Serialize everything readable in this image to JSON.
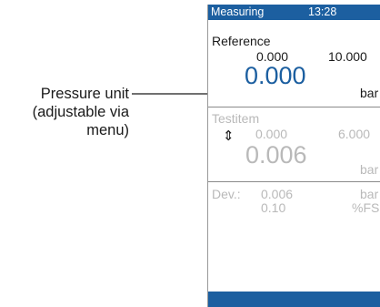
{
  "annotation": {
    "lines": [
      "Pressure unit",
      "(adjustable via",
      "menu)"
    ]
  },
  "device": {
    "status": {
      "mode": "Measuring",
      "clock": "13:28"
    },
    "reference": {
      "title": "Reference",
      "small_value": "0.000",
      "range_value": "10.000",
      "main_value": "0.000",
      "unit": "bar"
    },
    "testitem": {
      "title": "Testitem",
      "toggle_icon": "up-down-arrows-icon",
      "small_value": "0.000",
      "range_value": "6.000",
      "main_value": "0.006",
      "unit": "bar"
    },
    "deviation": {
      "label": "Dev.:",
      "value_abs": "0.006",
      "unit_abs": "bar",
      "value_pct": "0.10",
      "unit_pct": "%FS"
    }
  },
  "colors": {
    "accent": "#1c5fa0",
    "text_dark": "#1a1a1a",
    "text_grey": "#b9b9b9",
    "separator": "#8a8a8a"
  }
}
